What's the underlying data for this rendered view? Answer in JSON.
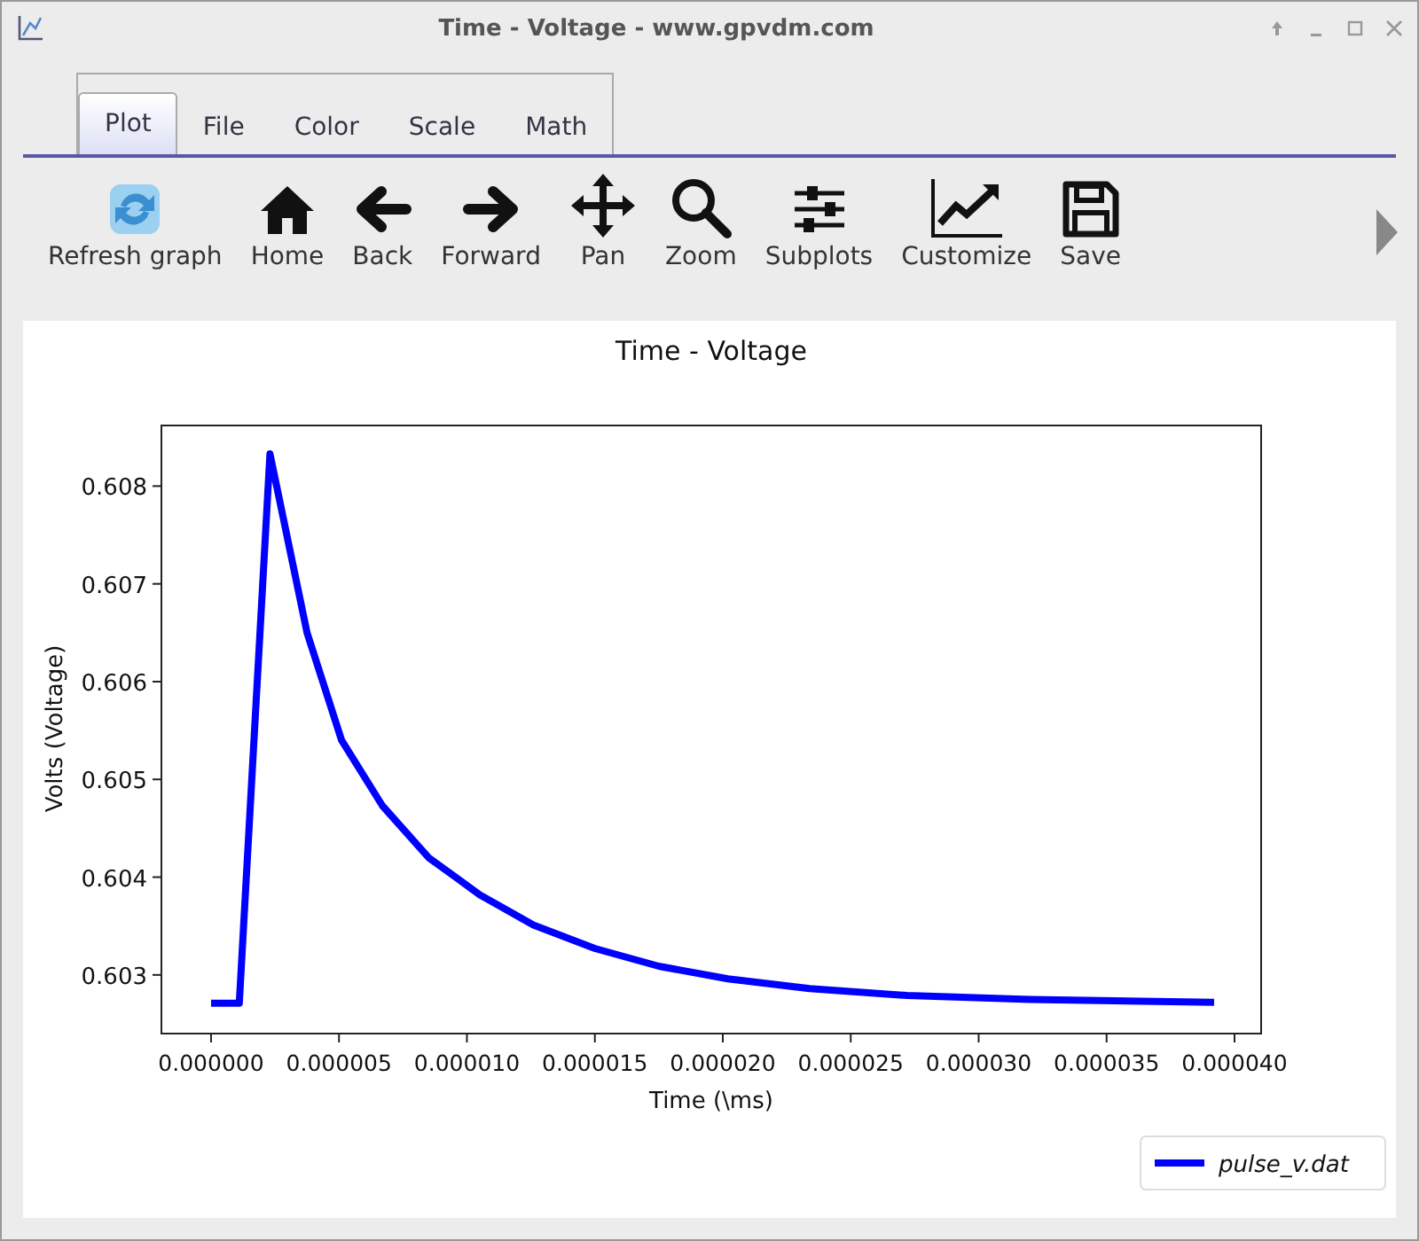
{
  "window": {
    "title": "Time - Voltage - www.gpvdm.com"
  },
  "tabs": [
    {
      "label": "Plot",
      "selected": true
    },
    {
      "label": "File",
      "selected": false
    },
    {
      "label": "Color",
      "selected": false
    },
    {
      "label": "Scale",
      "selected": false
    },
    {
      "label": "Math",
      "selected": false
    }
  ],
  "toolbar": [
    {
      "kind": "refresh",
      "label": "Refresh graph"
    },
    {
      "kind": "home",
      "label": "Home"
    },
    {
      "kind": "back",
      "label": "Back"
    },
    {
      "kind": "forward",
      "label": "Forward"
    },
    {
      "kind": "pan",
      "label": "Pan"
    },
    {
      "kind": "zoom",
      "label": "Zoom"
    },
    {
      "kind": "subplots",
      "label": "Subplots"
    },
    {
      "kind": "customize",
      "label": "Customize"
    },
    {
      "kind": "save",
      "label": "Save"
    }
  ],
  "plot": {
    "chart_data": {
      "type": "line",
      "title": "Time - Voltage",
      "xlabel": "Time (\\ms)",
      "ylabel": "Volts (Voltage)",
      "xlim": [
        -1.94e-06,
        4.104e-05
      ],
      "ylim": [
        0.6024,
        0.60862
      ],
      "xticks": [
        {
          "value": 0,
          "label": "0.000000"
        },
        {
          "value": 5e-06,
          "label": "0.000005"
        },
        {
          "value": 1e-05,
          "label": "0.000010"
        },
        {
          "value": 1.5e-05,
          "label": "0.000015"
        },
        {
          "value": 2e-05,
          "label": "0.000020"
        },
        {
          "value": 2.5e-05,
          "label": "0.000025"
        },
        {
          "value": 3e-05,
          "label": "0.000030"
        },
        {
          "value": 3.5e-05,
          "label": "0.000035"
        },
        {
          "value": 4e-05,
          "label": "0.000040"
        }
      ],
      "yticks": [
        {
          "value": 0.603,
          "label": "0.603"
        },
        {
          "value": 0.604,
          "label": "0.604"
        },
        {
          "value": 0.605,
          "label": "0.605"
        },
        {
          "value": 0.606,
          "label": "0.606"
        },
        {
          "value": 0.607,
          "label": "0.607"
        },
        {
          "value": 0.608,
          "label": "0.608"
        }
      ],
      "x": [
        0,
        1.1e-06,
        2.3e-06,
        3.75e-06,
        5.1e-06,
        6.7e-06,
        8.5e-06,
        1.05e-05,
        1.26e-05,
        1.5e-05,
        1.75e-05,
        2.02e-05,
        2.34e-05,
        2.72e-05,
        3.2e-05,
        3.92e-05
      ],
      "series": [
        {
          "name": "pulse_v.dat",
          "color": "#0000ff",
          "values": [
            0.60271,
            0.60271,
            0.60833,
            0.6065,
            0.6054,
            0.60473,
            0.6042,
            0.60382,
            0.60351,
            0.60327,
            0.60309,
            0.60296,
            0.60286,
            0.60279,
            0.60275,
            0.60272
          ]
        }
      ]
    }
  }
}
